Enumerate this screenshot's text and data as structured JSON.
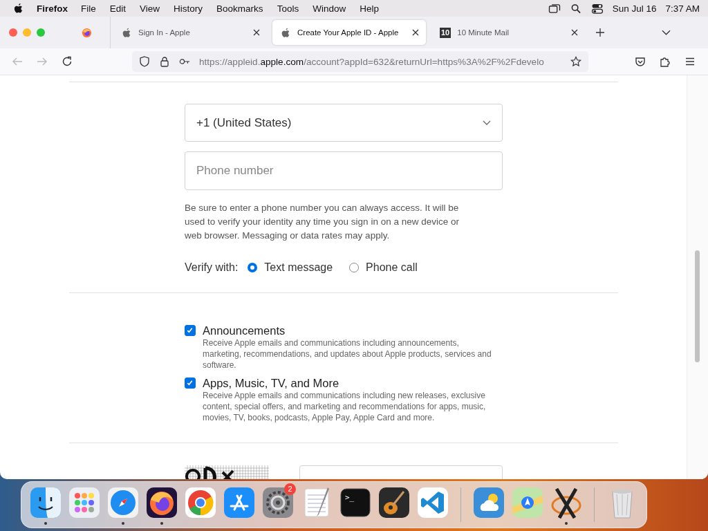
{
  "menubar": {
    "app": "Firefox",
    "items": [
      "File",
      "Edit",
      "View",
      "History",
      "Bookmarks",
      "Tools",
      "Window",
      "Help"
    ],
    "date": "Sun Jul 16",
    "time": "7:37 AM"
  },
  "tabs": [
    {
      "title": "Sign In - Apple",
      "kind": "apple",
      "selected": false
    },
    {
      "title": "Create Your Apple ID - Apple",
      "kind": "apple",
      "selected": true
    },
    {
      "title": "10 Minute Mail",
      "kind": "lettered",
      "favicon_text": "10",
      "selected": false
    }
  ],
  "address": {
    "url": "https://appleid.**apple.com**/account?appId=632&returnUrl=https%3A%2F%2Fdevelo"
  },
  "form": {
    "country_code": "+1 (United States)",
    "phone_placeholder": "Phone number",
    "help": "Be sure to enter a phone number you can always access. It will be used to verify your identity any time you sign in on a new device or web browser. Messaging or data rates may apply.",
    "verify_label": "Verify with:",
    "verify_options": [
      {
        "label": "Text message",
        "selected": true
      },
      {
        "label": "Phone call",
        "selected": false
      }
    ],
    "subscriptions": [
      {
        "title": "Announcements",
        "description": "Receive Apple emails and communications including announcements, marketing, recommendations, and updates about Apple products, services and software.",
        "checked": true
      },
      {
        "title": "Apps, Music, TV, and More",
        "description": "Receive Apple emails and communications including new releases, exclusive content, special offers, and marketing and recommendations for apps, music, movies, TV, books, podcasts, Apple Pay, Apple Card and more.",
        "checked": true
      }
    ]
  },
  "dock": {
    "groups": [
      [
        {
          "kind": "finder",
          "running": true
        },
        {
          "kind": "launchpad",
          "running": false
        },
        {
          "kind": "safari",
          "running": true
        },
        {
          "kind": "firefox",
          "running": true
        },
        {
          "kind": "chrome",
          "running": false
        },
        {
          "kind": "appstore",
          "running": false
        },
        {
          "kind": "settings",
          "running": false,
          "badge": "2"
        },
        {
          "kind": "textedit",
          "running": false
        },
        {
          "kind": "terminal",
          "running": false,
          "prompt": ">_"
        },
        {
          "kind": "garageband",
          "running": false
        },
        {
          "kind": "vscode",
          "running": false
        }
      ],
      [
        {
          "kind": "weather",
          "running": false
        },
        {
          "kind": "maps",
          "running": false
        },
        {
          "kind": "xquartz",
          "running": true
        }
      ],
      [
        {
          "kind": "trash",
          "running": false
        }
      ]
    ]
  }
}
